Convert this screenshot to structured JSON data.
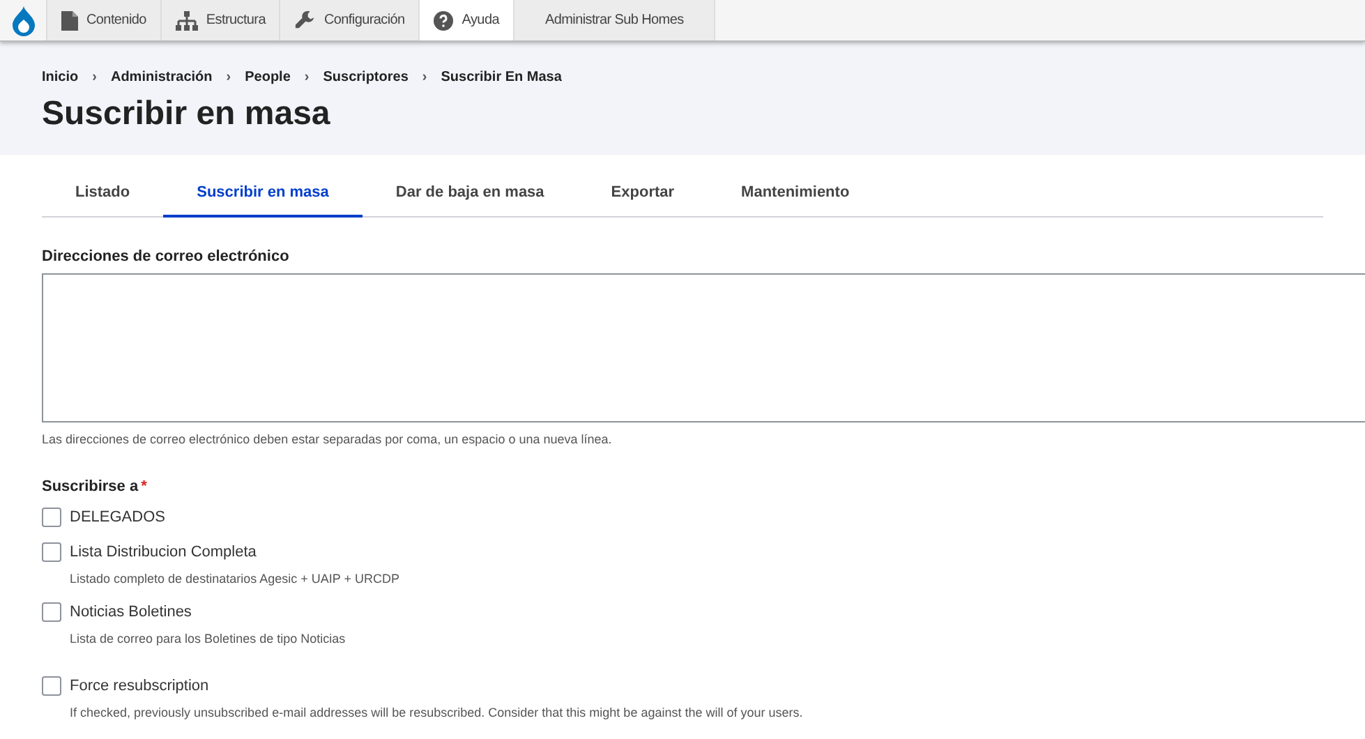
{
  "toolbar": {
    "items": [
      {
        "label": "Contenido",
        "selected": false
      },
      {
        "label": "Estructura",
        "selected": false
      },
      {
        "label": "Configuración",
        "selected": false
      },
      {
        "label": "Ayuda",
        "selected": true
      },
      {
        "label": "Administrar Sub Homes",
        "selected": false
      }
    ]
  },
  "breadcrumb": [
    {
      "label": "Inicio",
      "separator": "›"
    },
    {
      "label": "Administración",
      "separator": "›"
    },
    {
      "label": "People",
      "separator": "›"
    },
    {
      "label": "Suscriptores",
      "separator": "›"
    },
    {
      "label": "Suscribir En Masa"
    }
  ],
  "page_title": "Suscribir en masa",
  "tabs": [
    {
      "label": "Listado",
      "selected": false
    },
    {
      "label": "Suscribir en masa",
      "selected": true
    },
    {
      "label": "Dar de baja en masa",
      "selected": false
    },
    {
      "label": "Exportar",
      "selected": false
    },
    {
      "label": "Mantenimiento",
      "selected": false
    }
  ],
  "emails": {
    "label": "Direcciones de correo electrónico",
    "description": "Las direcciones de correo electrónico deben estar separadas por coma, un espacio o una nueva línea."
  },
  "subscribe": {
    "label": "Suscribirse a",
    "required_mark": "*",
    "options": [
      {
        "label": "DELEGADOS",
        "checked": false
      },
      {
        "label": "Lista Distribucion Completa",
        "checked": false,
        "description": "Listado completo de destinatarios Agesic + UAIP + URCDP"
      },
      {
        "label": "Noticias Boletines",
        "checked": false,
        "description": "Lista de correo para los Boletines de tipo Noticias"
      }
    ]
  },
  "force": {
    "label": "Force resubscription",
    "checked": false,
    "description": "If checked, previously unsubscribed e-mail addresses will be resubscribed. Consider that this might be against the will of your users."
  }
}
